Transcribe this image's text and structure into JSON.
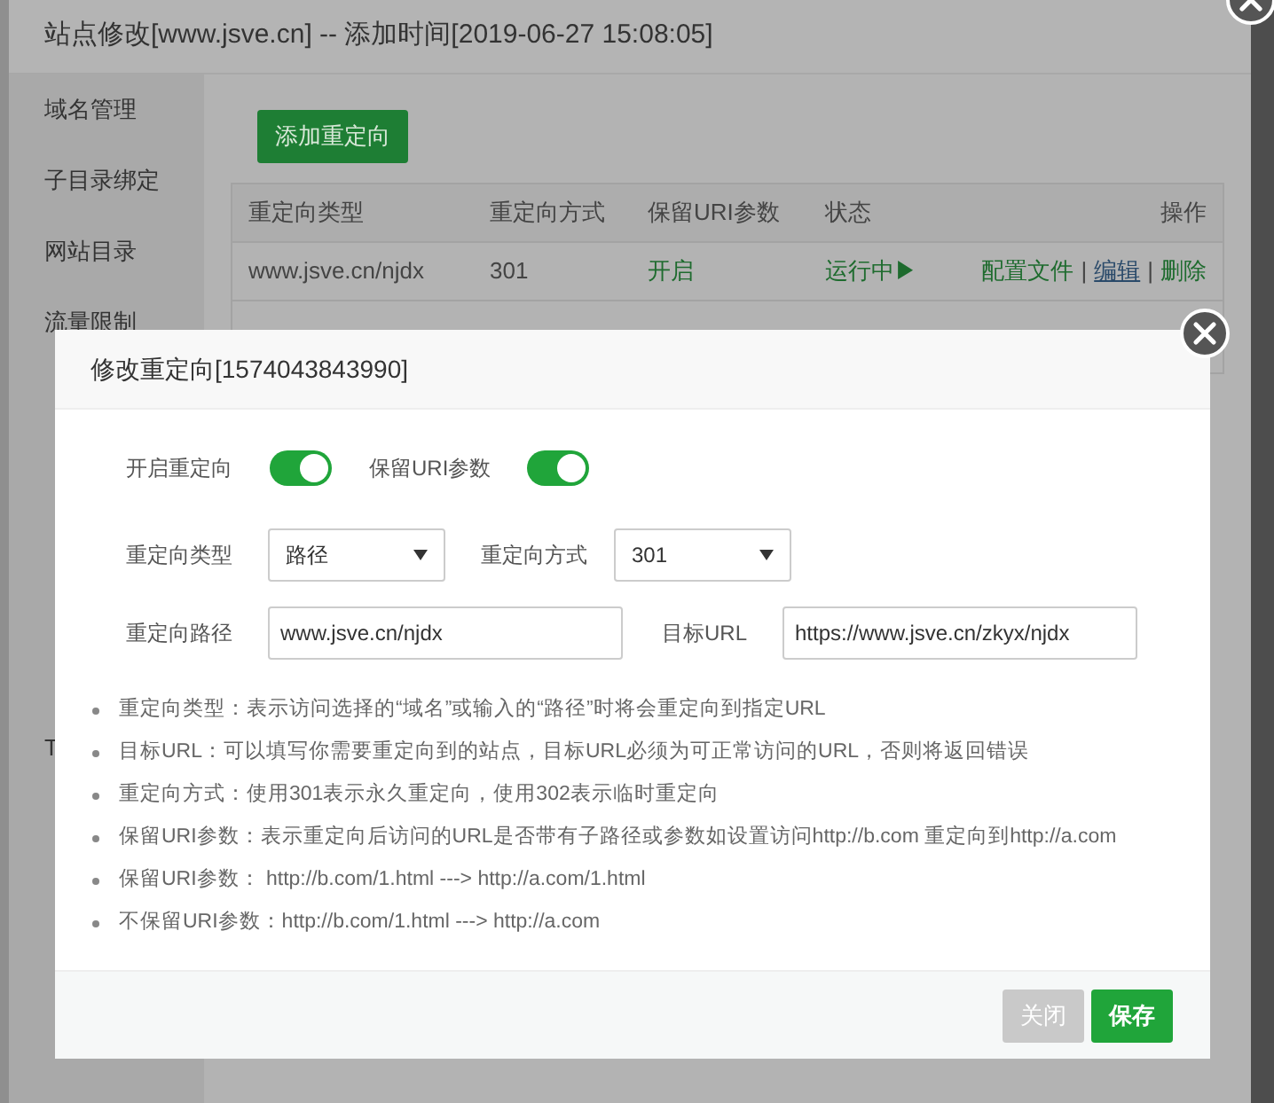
{
  "back_dialog": {
    "title": "站点修改[www.jsve.cn] -- 添加时间[2019-06-27 15:08:05]",
    "sidebar": {
      "items": [
        {
          "label": "域名管理",
          "selected": false
        },
        {
          "label": "子目录绑定",
          "selected": false
        },
        {
          "label": "网站目录",
          "selected": false
        },
        {
          "label": "流量限制",
          "selected": false
        },
        {
          "label": "T",
          "selected": false
        }
      ]
    },
    "add_button": "添加重定向",
    "table": {
      "columns": [
        "重定向类型",
        "重定向方式",
        "保留URI参数",
        "状态",
        "操作"
      ],
      "rows": [
        {
          "cells": [
            "www.jsve.cn/njdx",
            "301",
            "开启",
            "运行中▶"
          ],
          "actions": [
            "配置文件",
            "编辑",
            "删除"
          ],
          "separator": "|"
        }
      ]
    }
  },
  "modal": {
    "title": "修改重定向[1574043843990]",
    "toggles": [
      {
        "label": "开启重定向",
        "on": true
      },
      {
        "label": "保留URI参数",
        "on": true
      }
    ],
    "selects": [
      {
        "label": "重定向类型",
        "value": "路径"
      },
      {
        "label": "重定向方式",
        "value": "301"
      }
    ],
    "fields": [
      {
        "label": "重定向路径",
        "value": "www.jsve.cn/njdx"
      },
      {
        "label": "目标URL",
        "value": "https://www.jsve.cn/zkyx/njdx"
      }
    ],
    "notes": [
      "重定向类型：表示访问选择的“域名”或输入的“路径”时将会重定向到指定URL",
      "目标URL：可以填写你需要重定向到的站点，目标URL必须为可正常访问的URL，否则将返回错误",
      "重定向方式：使用301表示永久重定向，使用302表示临时重定向",
      "保留URI参数：表示重定向后访问的URL是否带有子路径或参数如设置访问http://b.com 重定向到http://a.com",
      "保留URI参数： http://b.com/1.html ---> http://a.com/1.html",
      "不保留URI参数：http://b.com/1.html ---> http://a.com"
    ],
    "buttons": [
      {
        "label": "关闭",
        "kind": "secondary"
      },
      {
        "label": "保存",
        "kind": "primary"
      }
    ]
  }
}
